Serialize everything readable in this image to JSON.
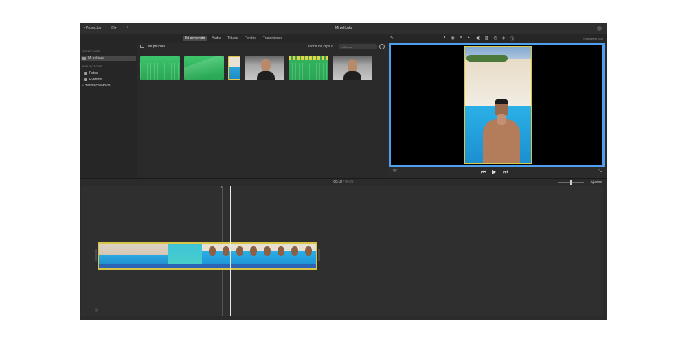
{
  "titlebar": {
    "back_label": "‹ Proyectos",
    "title": "Mi película"
  },
  "tabs": [
    {
      "label": "Mi contenido",
      "active": true
    },
    {
      "label": "Audio",
      "active": false
    },
    {
      "label": "Títulos",
      "active": false
    },
    {
      "label": "Fondos",
      "active": false
    },
    {
      "label": "Transiciones",
      "active": false
    }
  ],
  "viewer_tools": {
    "icons": [
      "color-balance-icon",
      "color-correction-icon",
      "crop-icon",
      "stabilization-icon",
      "volume-icon",
      "noise-reduction-icon",
      "speed-icon",
      "filter-icon",
      "info-icon"
    ],
    "reset_label": "Restablecer todo"
  },
  "sidebar": {
    "section_content": "CONTENIDO",
    "project_item": "Mi película",
    "section_libraries": "BIBLIOTECAS",
    "items": [
      {
        "label": "Fotos",
        "icon": "photos-icon"
      },
      {
        "label": "Eventos",
        "icon": "events-icon"
      }
    ],
    "library": "› Biblioteca iMovie"
  },
  "browser": {
    "label": "Mi película",
    "filter": "Todos los clips ◊",
    "search_placeholder": "Buscar"
  },
  "playback": {
    "current_time": "00:18",
    "separator": "/",
    "total_time": "00:29"
  },
  "timeline": {
    "adjust_label": "Ajustes"
  },
  "colors": {
    "selection_blue": "#4ea0ee",
    "clip_yellow": "#d8c447",
    "audio_green": "#2aa754"
  }
}
